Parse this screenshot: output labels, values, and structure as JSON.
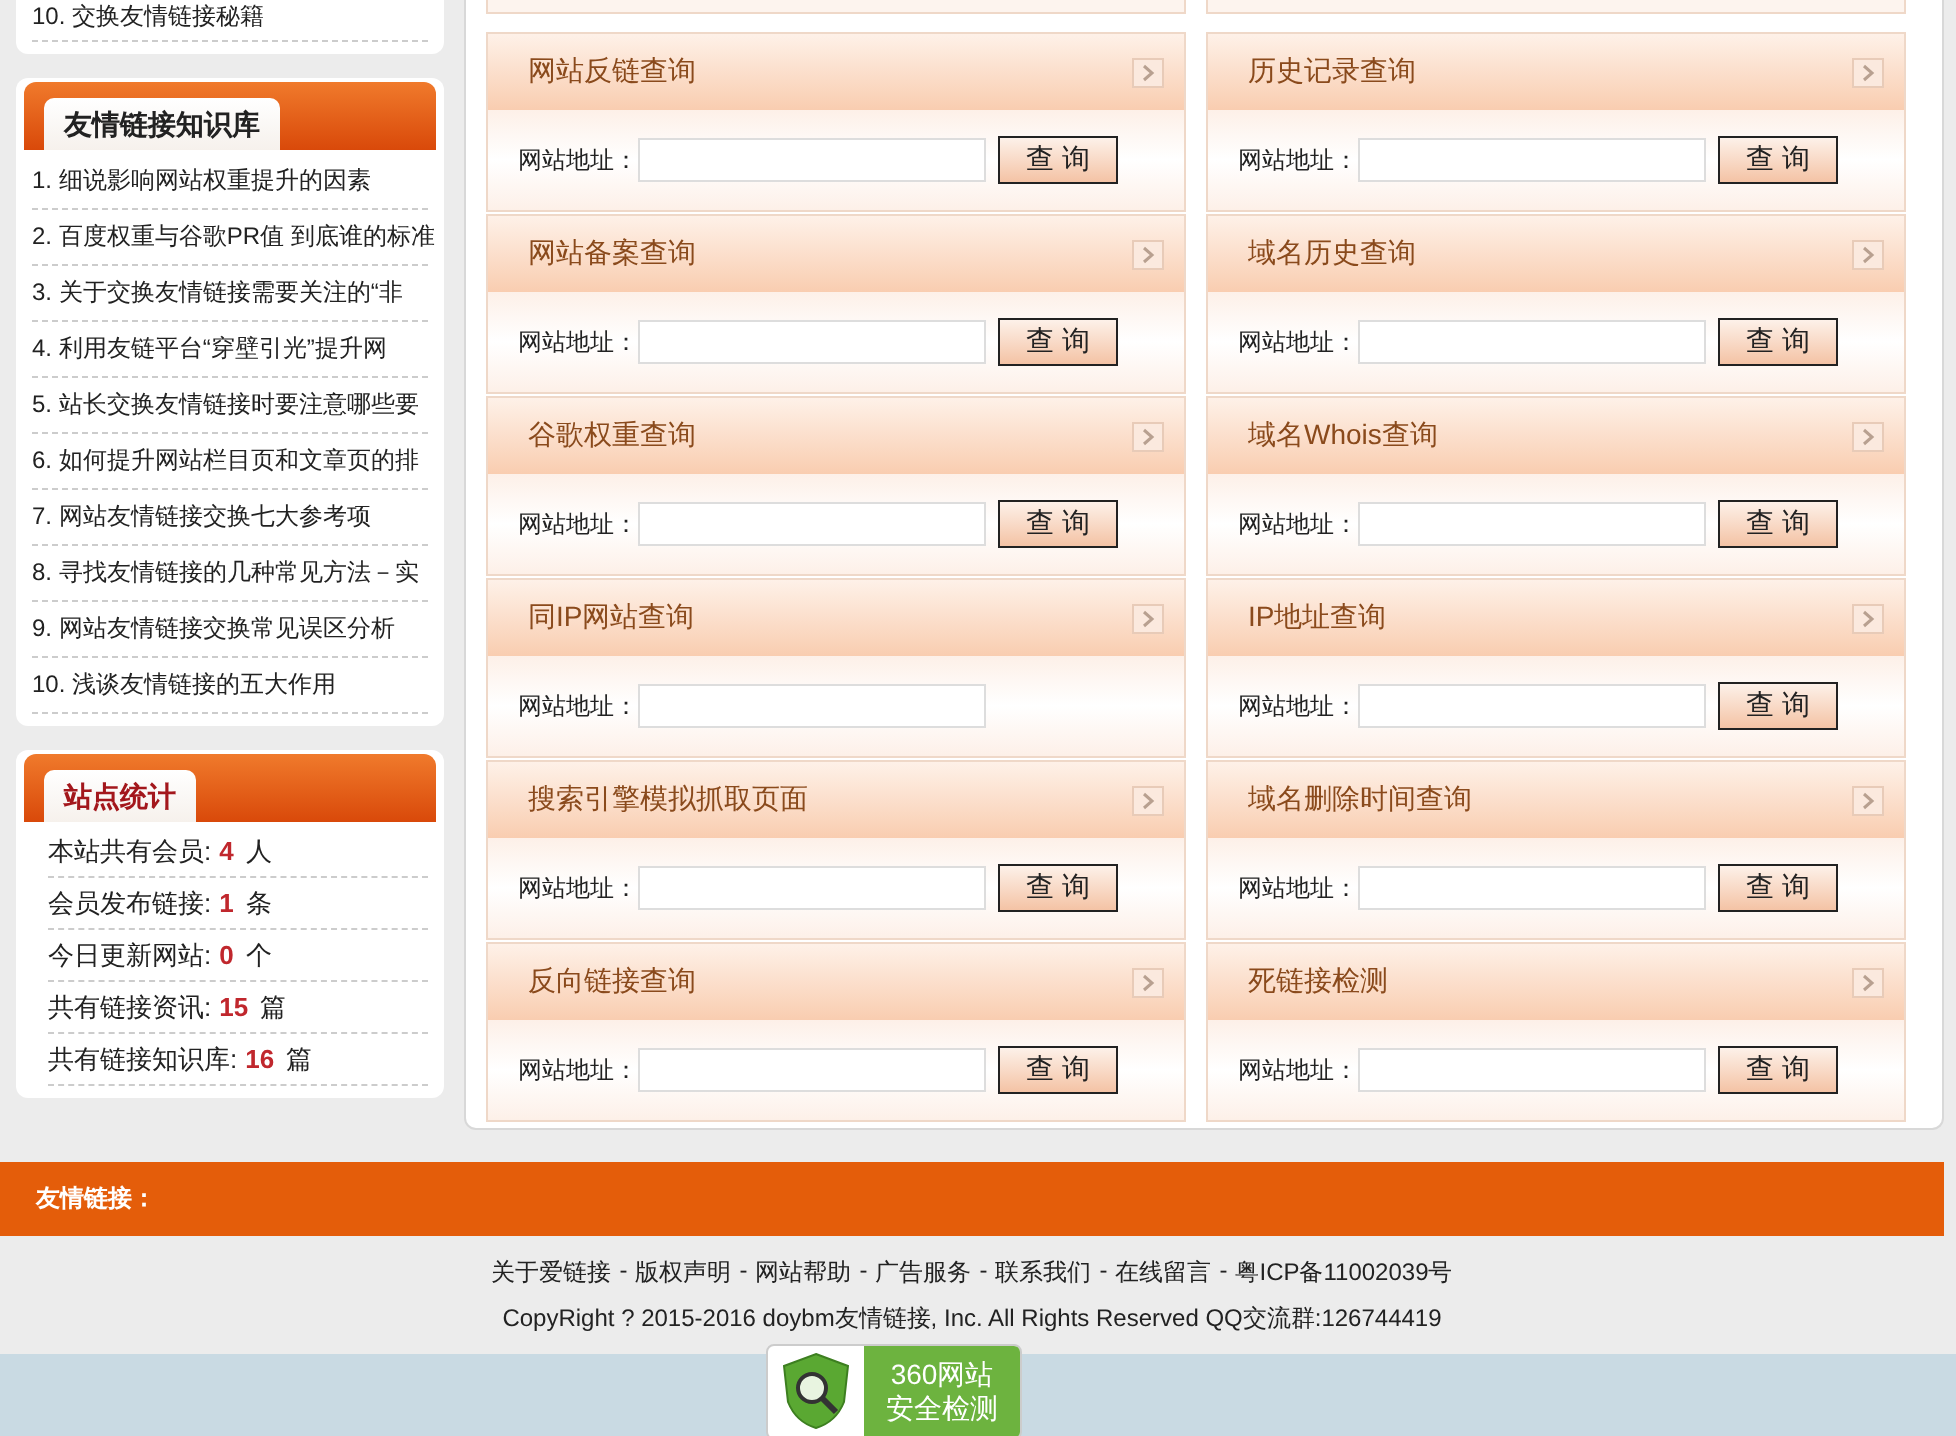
{
  "sidebar": {
    "top_item": "10. 交换友情链接秘籍",
    "knowledge": {
      "title": "友情链接知识库",
      "items": [
        "1. 细说影响网站权重提升的因素",
        "2. 百度权重与谷歌PR值 到底谁的标准",
        "3. 关于交换友情链接需要关注的“非",
        "4. 利用友链平台“穿壁引光”提升网",
        "5. 站长交换友情链接时要注意哪些要",
        "6. 如何提升网站栏目页和文章页的排",
        "7. 网站友情链接交换七大参考项",
        "8. 寻找友情链接的几种常见方法－实",
        "9. 网站友情链接交换常见误区分析",
        "10. 浅谈友情链接的五大作用"
      ]
    },
    "stats": {
      "title": "站点统计",
      "items": [
        {
          "label": "本站共有会员:",
          "value": "4",
          "unit": "人"
        },
        {
          "label": "会员发布链接:",
          "value": "1",
          "unit": "条"
        },
        {
          "label": "今日更新网站:",
          "value": "0",
          "unit": "个"
        },
        {
          "label": "共有链接资讯:",
          "value": "15",
          "unit": "篇"
        },
        {
          "label": "共有链接知识库:",
          "value": "16",
          "unit": "篇"
        }
      ]
    }
  },
  "tools": [
    {
      "title": "网站反链查询",
      "field_label": "网站地址：",
      "button": "查 询"
    },
    {
      "title": "历史记录查询",
      "field_label": "网站地址：",
      "button": "查 询"
    },
    {
      "title": "网站备案查询",
      "field_label": "网站地址：",
      "button": "查 询"
    },
    {
      "title": "域名历史查询",
      "field_label": "网站地址：",
      "button": "查 询"
    },
    {
      "title": "谷歌权重查询",
      "field_label": "网站地址：",
      "button": "查 询"
    },
    {
      "title": "域名Whois查询",
      "field_label": "网站地址：",
      "button": "查 询"
    },
    {
      "title": "同IP网站查询",
      "field_label": "网站地址："
    },
    {
      "title": "IP地址查询",
      "field_label": "网站地址：",
      "button": "查 询"
    },
    {
      "title": "搜索引擎模拟抓取页面",
      "field_label": "网站地址：",
      "button": "查 询"
    },
    {
      "title": "域名删除时间查询",
      "field_label": "网站地址：",
      "button": "查 询"
    },
    {
      "title": "反向链接查询",
      "field_label": "网站地址：",
      "button": "查 询"
    },
    {
      "title": "死链接检测",
      "field_label": "网站地址：",
      "button": "查 询"
    }
  ],
  "footer": {
    "links_label": "友情链接：",
    "separator": "-",
    "links": [
      "关于爱链接",
      "版权声明",
      "网站帮助",
      "广告服务",
      "联系我们",
      "在线留言",
      "粤ICP备11002039号"
    ],
    "copyright": "CopyRight ? 2015-2016 doybm友情链接, Inc. All Rights Reserved QQ交流群:126744419",
    "badge": {
      "line1": "360网站",
      "line2": "安全检测"
    }
  }
}
